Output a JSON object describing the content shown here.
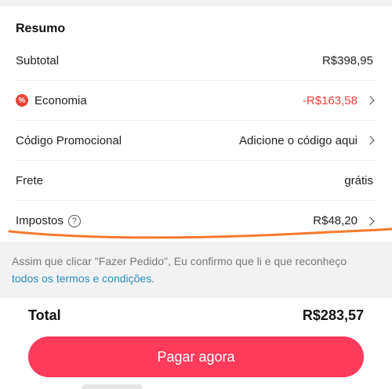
{
  "summary": {
    "title": "Resumo",
    "rows": [
      {
        "label": "Subtotal",
        "value": "R$398,95"
      },
      {
        "icon": "discount-badge-icon",
        "icon_glyph": "%",
        "label": "Economia",
        "value": "-R$163,58"
      },
      {
        "label": "Código Promocional",
        "value": "Adicione o código aqui"
      },
      {
        "label": "Frete",
        "value": "grátis"
      },
      {
        "label": "Impostos",
        "help_glyph": "?",
        "value": "R$48,20"
      }
    ]
  },
  "terms": {
    "text": "Assim que clicar \"Fazer Pedido\", Eu confirmo que li e que reconheço",
    "link": "todos os termos e condições",
    "suffix": "."
  },
  "total": {
    "label": "Total",
    "value": "R$283,57"
  },
  "pay_button": {
    "label": "Pagar agora"
  },
  "colors": {
    "accent_red": "#e8433a",
    "button": "#fe3b5b",
    "link": "#2a8fbf",
    "annotation_stroke": "#f57a2e"
  }
}
